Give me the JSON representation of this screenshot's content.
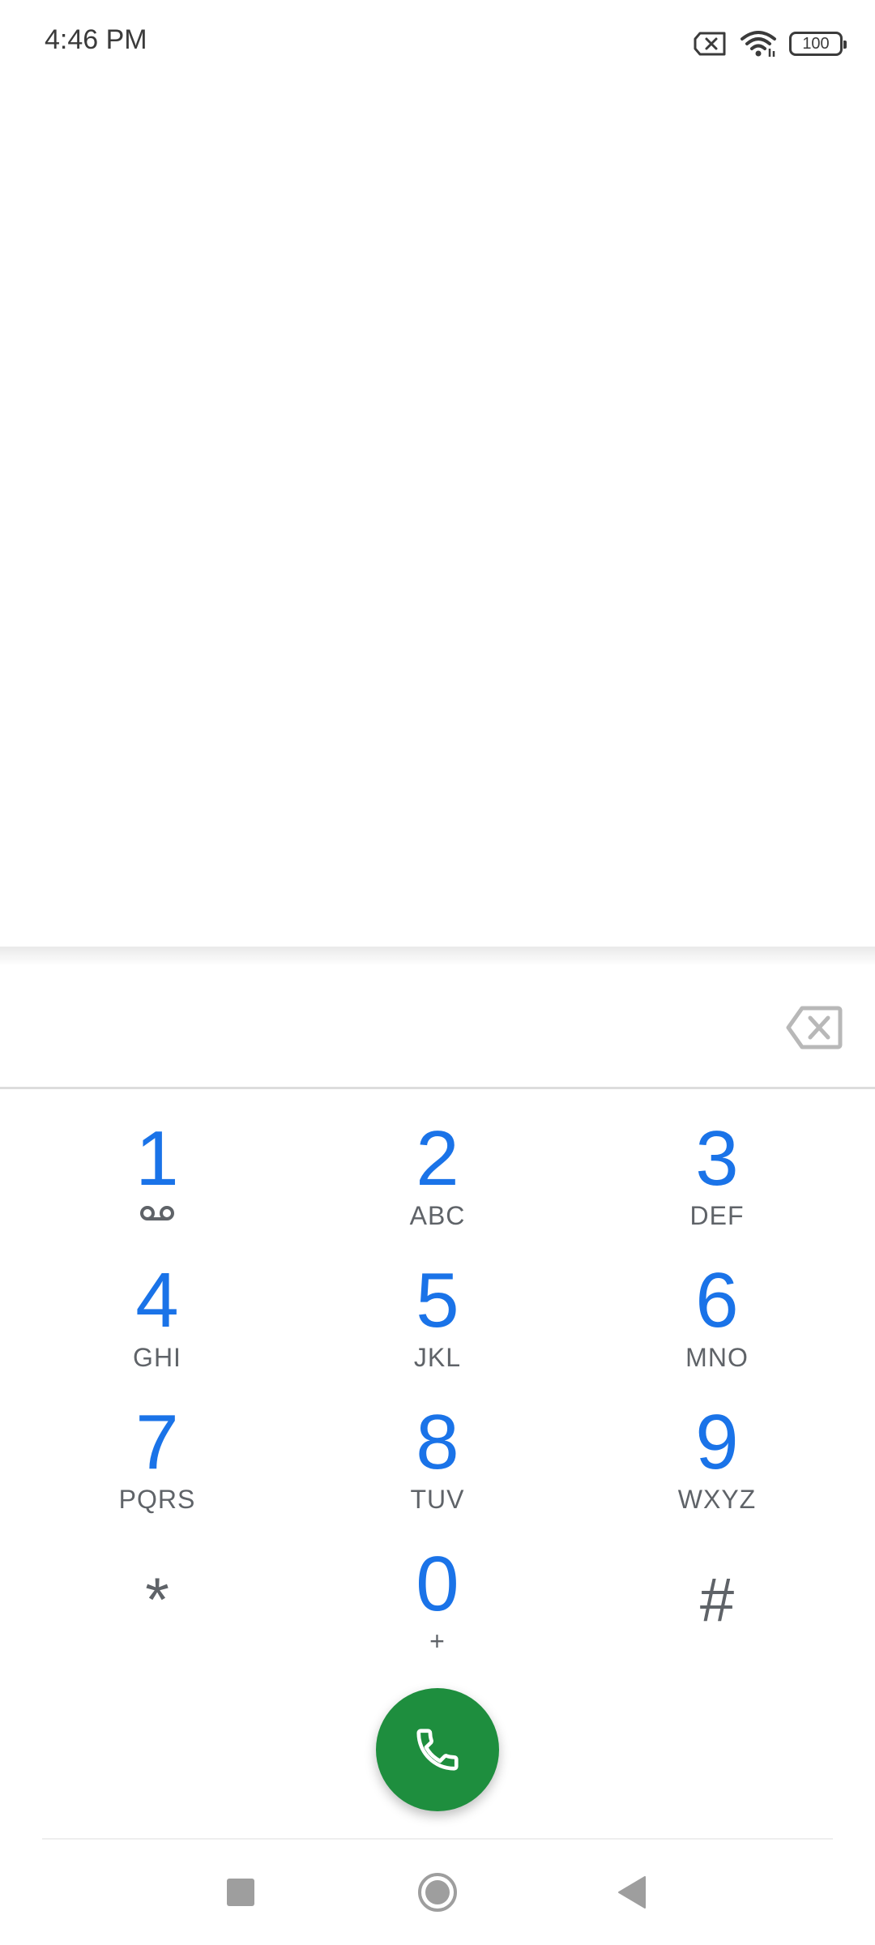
{
  "status_bar": {
    "time": "4:46 PM",
    "battery_level": "100",
    "icons": [
      "no-sim-icon",
      "wifi-icon",
      "battery-icon"
    ]
  },
  "dialer": {
    "digits_value": "",
    "keys": [
      {
        "digit": "1",
        "letters": ""
      },
      {
        "digit": "2",
        "letters": "ABC"
      },
      {
        "digit": "3",
        "letters": "DEF"
      },
      {
        "digit": "4",
        "letters": "GHI"
      },
      {
        "digit": "5",
        "letters": "JKL"
      },
      {
        "digit": "6",
        "letters": "MNO"
      },
      {
        "digit": "7",
        "letters": "PQRS"
      },
      {
        "digit": "8",
        "letters": "TUV"
      },
      {
        "digit": "9",
        "letters": "WXYZ"
      },
      {
        "digit": "*",
        "letters": ""
      },
      {
        "digit": "0",
        "letters": "+"
      },
      {
        "digit": "#",
        "letters": ""
      }
    ]
  },
  "colors": {
    "digit": "#1a73e8",
    "letters": "#5f6368",
    "call_button": "#1e8e3e",
    "nav_icon": "#9e9e9e"
  },
  "navigation": {
    "icons": [
      "recents-icon",
      "home-icon",
      "back-icon"
    ]
  }
}
